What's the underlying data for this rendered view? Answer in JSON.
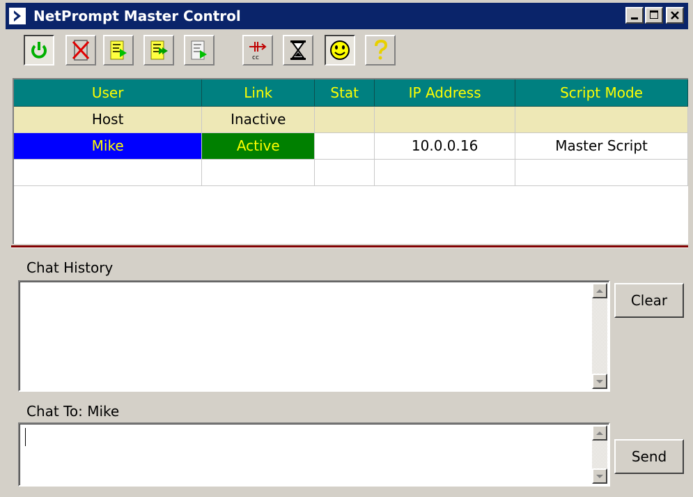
{
  "window": {
    "title": "NetPrompt Master Control"
  },
  "toolbar": {
    "buttons": [
      {
        "icon": "power-icon",
        "pressed": true
      },
      {
        "icon": "disconnect-x-icon",
        "pressed": false
      },
      {
        "icon": "script-send-icon",
        "pressed": false
      },
      {
        "icon": "script-send-all-icon",
        "pressed": false
      },
      {
        "icon": "document-send-icon",
        "pressed": false
      },
      {
        "icon": "closed-caption-icon",
        "pressed": false
      },
      {
        "icon": "hourglass-icon",
        "pressed": false
      },
      {
        "icon": "smiley-icon",
        "pressed": true
      },
      {
        "icon": "help-question-icon",
        "pressed": false
      }
    ]
  },
  "grid": {
    "headers": [
      "User",
      "Link",
      "Stat",
      "IP Address",
      "Script Mode"
    ],
    "rows": [
      {
        "user": "Host",
        "link": "Inactive",
        "stat": "",
        "ip": "",
        "mode": ""
      },
      {
        "user": "Mike",
        "link": "Active",
        "stat": "",
        "ip": "10.0.0.16",
        "mode": "Master Script"
      },
      {
        "user": "",
        "link": "",
        "stat": "",
        "ip": "",
        "mode": ""
      }
    ]
  },
  "chat": {
    "history_label": "Chat History",
    "history_text": "",
    "clear_label": "Clear",
    "to_label": "Chat To: Mike",
    "message_value": "",
    "send_label": "Send"
  },
  "colors": {
    "header_bg": "#008080",
    "header_fg": "#ffff00",
    "host_row_bg": "#eee8b6",
    "selected_user_bg": "#0000ff",
    "active_link_bg": "#008000",
    "splitter": "#800000",
    "titlebar": "#0a246a"
  }
}
